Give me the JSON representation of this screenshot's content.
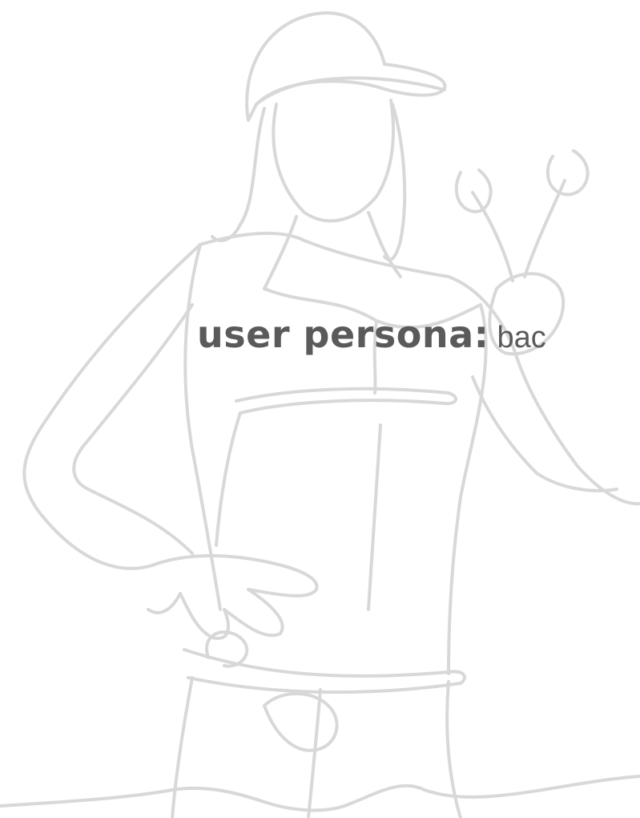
{
  "heading": {
    "title_bold": "user persona:",
    "title_rest": "bac"
  },
  "colors": {
    "line_art": "#d8d8d8",
    "text": "#5a5a5a",
    "background": "#ffffff"
  },
  "illustration": {
    "subject": "line-drawing-worker-with-wrenches"
  }
}
